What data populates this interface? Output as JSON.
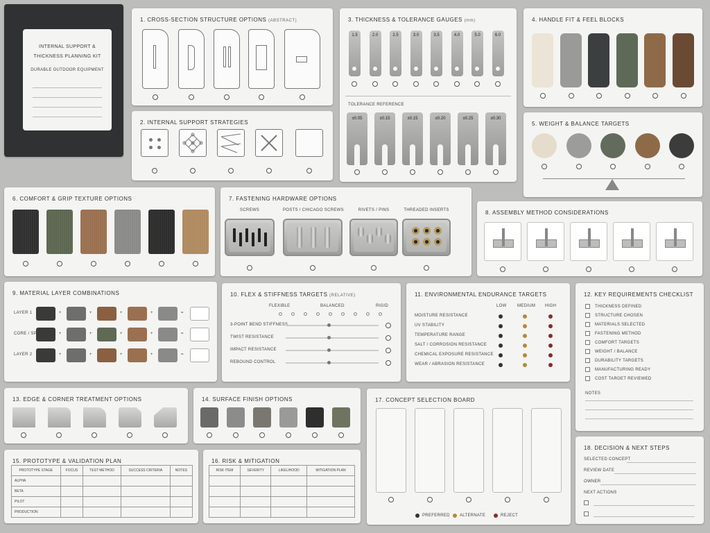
{
  "book": {
    "title_line1": "INTERNAL SUPPORT &",
    "title_line2": "THICKNESS PLANNING KIT",
    "subtitle": "DURABLE OUTDOOR EQUIPMENT"
  },
  "s1": {
    "title": "1. CROSS-SECTION STRUCTURE OPTIONS",
    "note": "(ABSTRACT)"
  },
  "s2": {
    "title": "2. INTERNAL SUPPORT STRATEGIES"
  },
  "s3": {
    "title": "3. THICKNESS & TOLERANCE GAUGES",
    "note": "(mm)",
    "gauges": [
      "1.5",
      "2.0",
      "2.5",
      "3.0",
      "3.5",
      "4.0",
      "5.0",
      "6.0"
    ],
    "tolerance_title": "TOLERANCE REFERENCE",
    "tolerances": [
      "±0.05",
      "±0.15",
      "±0.15",
      "±0.20",
      "±0.25",
      "±0.30"
    ]
  },
  "s4": {
    "title": "4. HANDLE FIT & FEEL BLOCKS",
    "colors": [
      "#ece4d6",
      "#9a9a98",
      "#3c3f40",
      "#5e6a57",
      "#8f6a48",
      "#6b4a34"
    ]
  },
  "s5": {
    "title": "5. WEIGHT & BALANCE TARGETS",
    "colors": [
      "#e6dccb",
      "#9c9c9a",
      "#636b5c",
      "#8f6a48",
      "#3c3c3c"
    ]
  },
  "s6": {
    "title": "6. COMFORT & GRIP TEXTURE OPTIONS",
    "colors": [
      "#2f2f2f",
      "#5c6650",
      "#9a7050",
      "#8a8a88",
      "#2c2c2c",
      "#b08a60"
    ]
  },
  "s7": {
    "title": "7. FASTENING HARDWARE OPTIONS",
    "labels": [
      "SCREWS",
      "POSTS / CHICAGO SCREWS",
      "RIVETS / PINS",
      "THREADED INSERTS"
    ]
  },
  "s8": {
    "title": "8. ASSEMBLY METHOD CONSIDERATIONS"
  },
  "s9": {
    "title": "9. MATERIAL LAYER COMBINATIONS",
    "rows": [
      "LAYER 1",
      "CORE / SPACER",
      "LAYER 2"
    ],
    "colors": [
      [
        "#3a3a3a",
        "#6e6e6e",
        "#8a6040",
        "#9a7050",
        "#8a8a88"
      ],
      [
        "#3a3a3a",
        "#6e6e6e",
        "#5f6a55",
        "#9a7050",
        "#8a8a88"
      ],
      [
        "#3a3a3a",
        "#6e6e6e",
        "#8a6040",
        "#9a7050",
        "#8a8a88"
      ]
    ]
  },
  "s10": {
    "title": "10. FLEX & STIFFNESS TARGETS",
    "note": "(RELATIVE)",
    "scale": [
      "FLEXIBLE",
      "BALANCED",
      "RIGID"
    ],
    "rows": [
      "3-POINT BEND STIFFNESS",
      "TWIST RESISTANCE",
      "IMPACT RESISTANCE",
      "REBOUND CONTROL"
    ]
  },
  "s11": {
    "title": "11. ENVIRONMENTAL ENDURANCE TARGETS",
    "levels": [
      "LOW",
      "MEDIUM",
      "HIGH"
    ],
    "rows": [
      "MOISTURE RESISTANCE",
      "UV STABILITY",
      "TEMPERATURE RANGE",
      "SALT / CORROSION RESISTANCE",
      "CHEMICAL EXPOSURE RESISTANCE",
      "WEAR / ABRASION RESISTANCE"
    ],
    "level_colors": [
      "#333333",
      "#b48a3a",
      "#8a2a2a"
    ]
  },
  "s12": {
    "title": "12. KEY REQUIREMENTS CHECKLIST",
    "items": [
      "THICKNESS DEFINED",
      "STRUCTURE CHOSEN",
      "MATERIALS SELECTED",
      "FASTENING METHOD",
      "COMFORT TARGETS",
      "WEIGHT / BALANCE",
      "DURABILITY TARGETS",
      "MANUFACTURING READY",
      "COST TARGET REVIEWED"
    ],
    "notes": "NOTES"
  },
  "s13": {
    "title": "13. EDGE & CORNER TREATMENT OPTIONS"
  },
  "s14": {
    "title": "14. SURFACE FINISH OPTIONS",
    "colors": [
      "#6a6a6a",
      "#8c8c8c",
      "#7a7670",
      "#9a9a98",
      "#2e2e2e",
      "#6e7460"
    ]
  },
  "s15": {
    "title": "15. PROTOTYPE & VALIDATION PLAN",
    "headers": [
      "PROTOTYPE STAGE",
      "FOCUS",
      "TEST METHOD",
      "SUCCESS CRITERIA",
      "NOTES"
    ],
    "rows": [
      "ALPHA",
      "BETA",
      "PILOT",
      "PRODUCTION"
    ]
  },
  "s16": {
    "title": "16. RISK & MITIGATION",
    "headers": [
      "RISK ITEM",
      "SEVERITY",
      "LIKELIHOOD",
      "MITIGATION PLAN"
    ]
  },
  "s17": {
    "title": "17. CONCEPT SELECTION BOARD",
    "legend": [
      "PREFERRED",
      "ALTERNATE",
      "REJECT"
    ],
    "legend_colors": [
      "#333333",
      "#b48a3a",
      "#8a2a2a"
    ]
  },
  "s18": {
    "title": "18. DECISION & NEXT STEPS",
    "fields": [
      "SELECTED CONCEPT",
      "REVIEW DATE",
      "OWNER"
    ],
    "next": "NEXT ACTIONS"
  }
}
